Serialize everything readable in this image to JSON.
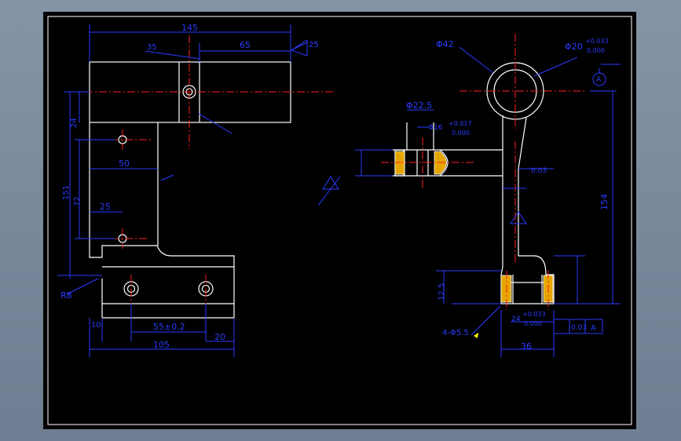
{
  "dimensions": {
    "d145": "145",
    "d65": "65",
    "d35": "35",
    "d24": "24",
    "d151": "151",
    "d72": "72",
    "d50": "50",
    "d25": "25",
    "r8": "R8",
    "d10": "10",
    "d55": "55±0.2",
    "d105": "105",
    "d20": "20",
    "phi42": "Φ42",
    "phi20": "Φ20",
    "tol_phi20_up": "+0.033",
    "tol_phi20_low": "0.000",
    "phi22": "Φ22.5",
    "phi16": "Φ16",
    "tol_phi16_up": "+0.017",
    "tol_phi16_low": "0.000",
    "d154": "154",
    "d36": "36",
    "holes": "4-Φ5.5",
    "perp": "0.03",
    "datum": "A",
    "d12_5": "12.5",
    "d24r": "24",
    "tol24_up": "+0.033",
    "tol24_low": "0.000"
  },
  "colors": {
    "frame": "#000000",
    "outline": "#ffffff",
    "dimension": "#2a3cff",
    "center": "#ff2020",
    "marker": "#ffff00"
  }
}
